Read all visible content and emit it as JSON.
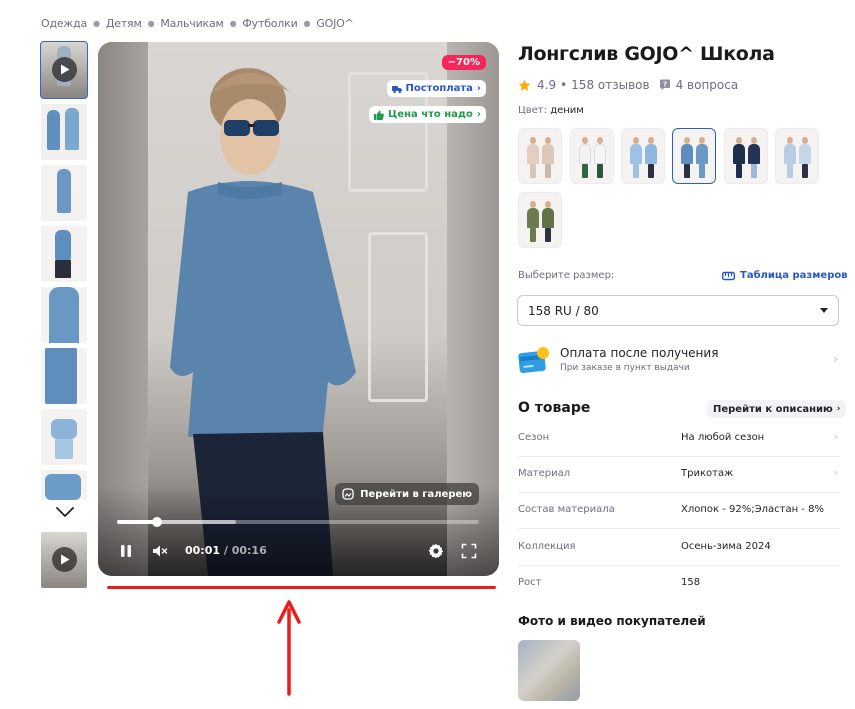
{
  "breadcrumb": [
    "Одежда",
    "Детям",
    "Мальчикам",
    "Футболки",
    "GOJO^"
  ],
  "product": {
    "title": "Лонгслив GOJO^ Школа",
    "rating": "4.9",
    "reviews": "158 отзывов",
    "questions": "4 вопроса",
    "color_label": "Цвет:",
    "color_value": "деним"
  },
  "media": {
    "discount": "−70%",
    "postpay_pill": "Постоплата",
    "price_pill": "Цена что надо",
    "gallery_button": "Перейти в галерею",
    "time_current": "00:01",
    "time_separator": " / ",
    "time_total": "00:16",
    "progress": 0.11,
    "buffered": 0.33
  },
  "size": {
    "label": "Выберите размер:",
    "table_link": "Таблица размеров",
    "selected": "158 RU / 80"
  },
  "payment": {
    "title": "Оплата после получения",
    "subtitle": "При заказе в пункт выдачи"
  },
  "about": {
    "title": "О товаре",
    "link": "Перейти к описанию",
    "specs": [
      {
        "key": "Сезон",
        "value": "На любой сезон"
      },
      {
        "key": "Материал",
        "value": "Трикотаж"
      },
      {
        "key": "Состав материала",
        "value": "Хлопок - 92%;Эластан - 8%"
      },
      {
        "key": "Коллекция",
        "value": "Осень-зима 2024"
      },
      {
        "key": "Рост",
        "value": "158"
      }
    ]
  },
  "buyers": {
    "title": "Фото и видео покупателей"
  },
  "colors": {
    "accent_blue": "#2957c7",
    "discount_pink": "#f5265a",
    "price_green": "#1e9a4a",
    "annotation_red": "#ea1c1c",
    "star": "#ffa800"
  },
  "icons": [
    "play-icon",
    "chevron-down-icon",
    "star-icon",
    "question-icon",
    "ruler-icon",
    "card-icon",
    "pause-icon",
    "mute-icon",
    "gear-icon",
    "fullscreen-icon",
    "gallery-icon",
    "truck-icon",
    "thumb-up-icon",
    "arrow-up-icon"
  ]
}
